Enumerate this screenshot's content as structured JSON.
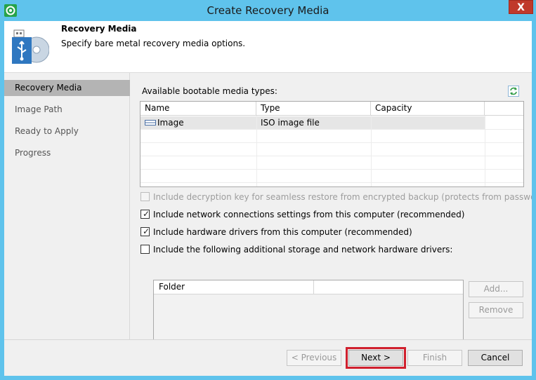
{
  "window": {
    "title": "Create Recovery Media",
    "close_glyph": "X"
  },
  "header": {
    "title": "Recovery Media",
    "subtitle": "Specify bare metal recovery media options."
  },
  "sidebar": {
    "items": [
      {
        "label": "Recovery Media",
        "active": true
      },
      {
        "label": "Image Path",
        "active": false
      },
      {
        "label": "Ready to Apply",
        "active": false
      },
      {
        "label": "Progress",
        "active": false
      }
    ]
  },
  "media": {
    "label": "Available bootable media types:",
    "columns": [
      "Name",
      "Type",
      "Capacity"
    ],
    "rows": [
      {
        "name": "Image",
        "type": "ISO image file",
        "capacity": ""
      }
    ]
  },
  "options": {
    "decryption_key": {
      "label": "Include decryption key for seamless restore from encrypted backup (protects from password loss)",
      "checked": false,
      "enabled": false
    },
    "network_settings": {
      "label": "Include network connections settings from this computer (recommended)",
      "checked": true,
      "enabled": true
    },
    "hardware_drivers": {
      "label": "Include hardware drivers from this computer (recommended)",
      "checked": true,
      "enabled": true
    },
    "additional_drivers": {
      "label": "Include the following additional storage and network hardware drivers:",
      "checked": false,
      "enabled": true
    }
  },
  "folders": {
    "column": "Folder",
    "add_label": "Add...",
    "remove_label": "Remove"
  },
  "footer": {
    "previous_label": "< Previous",
    "next_label": "Next >",
    "finish_label": "Finish",
    "cancel_label": "Cancel"
  },
  "colors": {
    "titlebar": "#5fc3ec",
    "close": "#c0392b",
    "highlight": "#d0202e",
    "selected_sidebar": "#b4b4b4"
  }
}
